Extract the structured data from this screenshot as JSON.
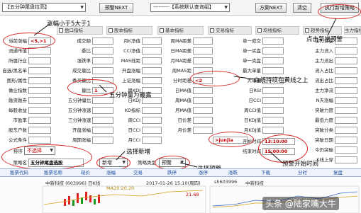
{
  "toolbar": {
    "left_combo": "【五分钟尾盘拉高】",
    "alert_btn": "预警NEXT",
    "right_combo": "---------【系统默认查询组】",
    "scheme_btn": "方案NEXT",
    "clear_btn": "清空",
    "exec_btn": "执行新增策略"
  },
  "headers": [
    "盘口指标",
    "股本指标",
    "基本指标",
    "交易指标",
    "均线指标",
    "趋势指标",
    "主力指标"
  ],
  "col1": {
    "labels": [
      "当前涨幅",
      "流通市值",
      "所属行业",
      "自选/黑名单",
      "图形/属性",
      "做业指数",
      "融资融券",
      "每股收益",
      "市盈率",
      "股东户数",
      "公式条件"
    ],
    "rise_value": "<5,>1"
  },
  "col2": {
    "labels": [
      "成交额",
      "委比",
      "涨跌率",
      "成交量比",
      "委买量比",
      "量比",
      "五分钟量比",
      "五分钟涨速",
      "三分钟涨速",
      "开盘涨幅",
      "周期涨幅"
    ],
    "volume_ratio_value": "1"
  },
  "col3": {
    "labels": [
      "月K净值",
      "CCI净值",
      "MA5线距",
      "开盘涨幅",
      "上证涨幅",
      "周KDJ",
      "日KDJ",
      "KD指标",
      "周CCI",
      "日CCI",
      "月CCI"
    ]
  },
  "col4": {
    "labels": [
      "周MA距差",
      "日MA距差",
      "月MA距差",
      "周MA5距",
      "分时距差",
      "日MA值",
      "周MA值",
      "月MA值",
      "日价差",
      "月价差"
    ],
    "timeshare_value": "<2",
    "content_value": ">junjia"
  },
  "col5": {
    "labels": [
      "单一成交",
      "单一买盘",
      "单一卖盘",
      "最大单量",
      "大单量",
      "日RSI",
      "日CCI",
      "周CCI值",
      "日KDJ值",
      "月KDJ值",
      "开始时间",
      "结束时间"
    ],
    "start_time": "13:10:00",
    "end_time": "15:00:00"
  },
  "col6": {
    "labels": [
      "主力资金",
      "主力流入",
      "主力流出",
      "流入占比",
      "流出占比",
      "主力净流",
      "N天涨幅",
      "突破力度",
      "最低力度",
      "突破分类",
      "突破日期",
      "今仍突破",
      "K线上穿"
    ]
  },
  "bottom_left": {
    "sort_label": "排序",
    "sort_value": "不选择",
    "strategy_label": "策略名",
    "strategy_value": "五分钟尾盘选股",
    "add_btn": "新增",
    "strategy_type_label": "策略类型",
    "strategy_type_value": "预警"
  },
  "annotations": {
    "a1": "涨幅小于5大于1",
    "a2": "五分钟量为最高",
    "a3": "点击新增预警",
    "a4": "白线持续在黄线之上",
    "a5": "选择新增",
    "a6": "选择预警",
    "a7": "预警开始时间"
  },
  "bluebar": [
    "股票代码",
    "股票名称",
    "现价",
    "涨幅",
    "交易",
    "跌停",
    "涨停",
    "涨跌",
    "下载",
    "分时",
    "复盘"
  ],
  "chart_strip": {
    "left_title": "中新科技 (603996)",
    "left_period": "日K线",
    "left_ma": "MA20:20.20",
    "left_date": "2017-01-26 15:10(周四)",
    "mid_value": "21.68",
    "right_code": "sh603996",
    "right_name": "中新科技"
  },
  "watermark": "头条 @陆家嘴大牛"
}
